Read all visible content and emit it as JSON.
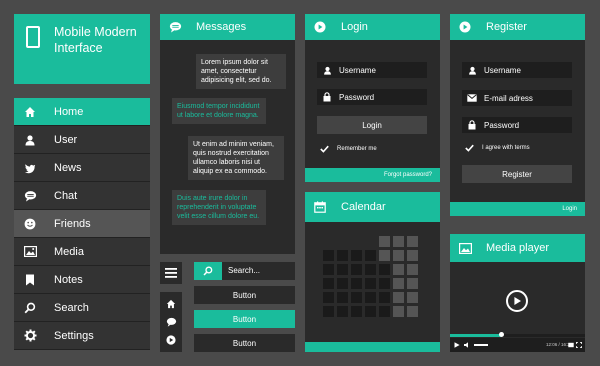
{
  "brand": {
    "title": "Mobile Modern Interface"
  },
  "nav": {
    "items": [
      {
        "label": "Home",
        "icon": "home-icon",
        "state": "active"
      },
      {
        "label": "User",
        "icon": "user-icon",
        "state": "normal"
      },
      {
        "label": "News",
        "icon": "bird-icon",
        "state": "normal"
      },
      {
        "label": "Chat",
        "icon": "chat-icon",
        "state": "normal"
      },
      {
        "label": "Friends",
        "icon": "smiley-icon",
        "state": "hover"
      },
      {
        "label": "Media",
        "icon": "image-icon",
        "state": "normal"
      },
      {
        "label": "Notes",
        "icon": "bookmark-icon",
        "state": "normal"
      },
      {
        "label": "Search",
        "icon": "search-icon",
        "state": "normal"
      },
      {
        "label": "Settings",
        "icon": "gear-icon",
        "state": "normal"
      }
    ]
  },
  "messages": {
    "title": "Messages",
    "list": [
      {
        "text": "Lorem ipsum dolor sit amet, consectetur adipisicing elit, sed do.",
        "side": "right"
      },
      {
        "text": "Eiusmod tempor incididunt ut labore et dolore magna.",
        "side": "left"
      },
      {
        "text": "Ut enim ad minim veniam, quis nostrud exercitation ullamco laboris nisi ut aliquip ex ea commodo.",
        "side": "right"
      },
      {
        "text": "Duis aute irure dolor in reprehenderit in voluptate velit esse cillum dolore eu.",
        "side": "left"
      }
    ]
  },
  "search": {
    "placeholder": "Search..."
  },
  "buttons": [
    {
      "label": "Button",
      "style": "dark"
    },
    {
      "label": "Button",
      "style": "teal"
    },
    {
      "label": "Button",
      "style": "dark"
    }
  ],
  "login": {
    "title": "Login",
    "username": "Username",
    "password": "Password",
    "submit": "Login",
    "remember": "Remember me",
    "forgot": "Forgot password?"
  },
  "register": {
    "title": "Register",
    "username": "Username",
    "email": "E-mail adress",
    "password": "Password",
    "terms": "I agree with terms",
    "submit": "Register",
    "login_link": "Login"
  },
  "calendar": {
    "title": "Calendar"
  },
  "media": {
    "title": "Media player",
    "time": "12:06 / 16:26",
    "progress": 0.38
  },
  "colors": {
    "accent": "#1abc9c",
    "panel": "#2a2a2a",
    "background": "#4a4a4a"
  }
}
